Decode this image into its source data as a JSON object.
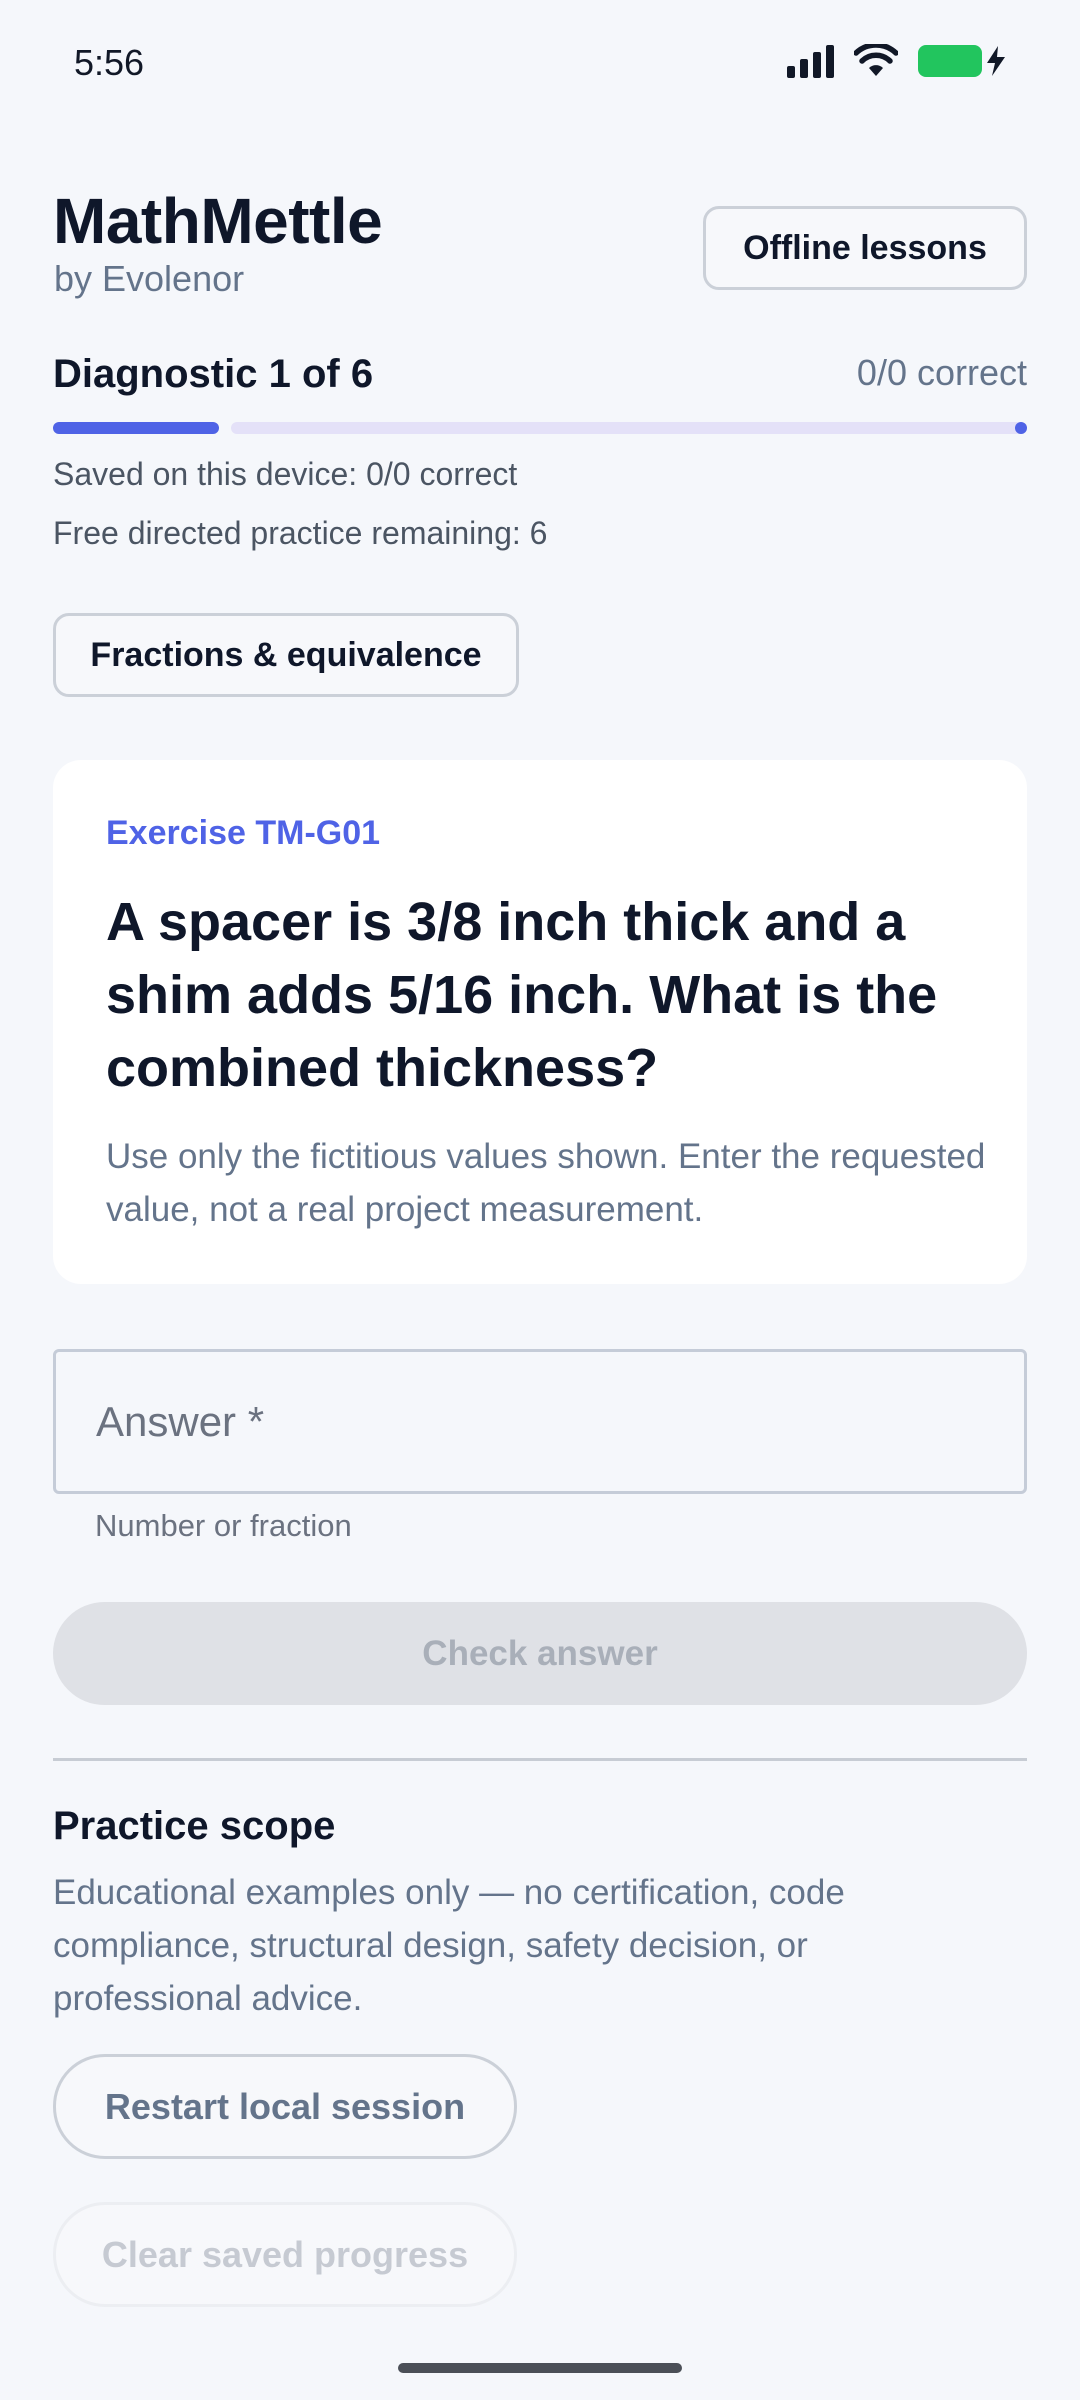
{
  "status_bar": {
    "time": "5:56",
    "icons": [
      "signal-icon",
      "wifi-icon",
      "battery-charging-icon"
    ],
    "battery_color": "#22c55e"
  },
  "header": {
    "title": "MathMettle",
    "subtitle": "by Evolenor",
    "offline_button": "Offline lessons"
  },
  "progress": {
    "label": "Diagnostic 1 of 6",
    "correct": "0/0 correct",
    "fraction_complete": 0.17,
    "fill_color": "#4f63e6",
    "track_color": "#e4e1f8",
    "saved_text": "Saved on this device: 0/0 correct",
    "free_practice_text": "Free directed practice remaining: 6"
  },
  "topic": {
    "label": "Fractions & equivalence"
  },
  "question": {
    "exercise_id": "Exercise TM-G01",
    "text": "A spacer is 3/8 inch thick and a shim adds 5/16 inch. What is the combined thickness?",
    "note": "Use only the fictitious values shown. Enter the requested value, not a real project measurement."
  },
  "answer": {
    "placeholder": "Answer *",
    "value": "",
    "helper": "Number or fraction"
  },
  "check_button": {
    "label": "Check answer",
    "enabled": false
  },
  "scope": {
    "title": "Practice scope",
    "text": "Educational examples only — no certification, code compliance, structural design, safety decision, or professional advice."
  },
  "actions": {
    "restart_label": "Restart local session",
    "clear_label": "Clear saved progress"
  },
  "colors": {
    "accent": "#4f63e6",
    "background": "#f5f7fb"
  }
}
